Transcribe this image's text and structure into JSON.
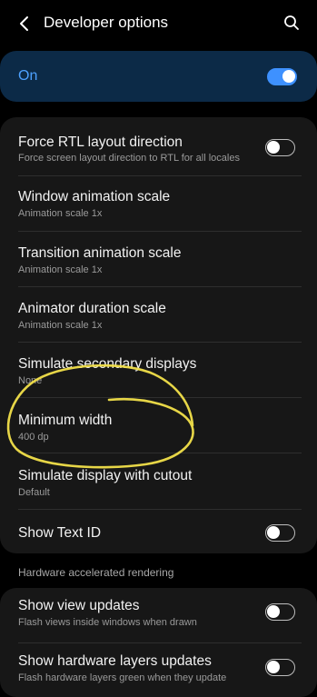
{
  "header": {
    "title": "Developer options",
    "back_icon": "back-arrow-icon",
    "search_icon": "search-icon"
  },
  "master_switch": {
    "label": "On",
    "state": "on"
  },
  "settings": [
    {
      "title": "Force RTL layout direction",
      "subtitle": "Force screen layout direction to RTL for all locales",
      "toggle": "off"
    },
    {
      "title": "Window animation scale",
      "subtitle": "Animation scale 1x"
    },
    {
      "title": "Transition animation scale",
      "subtitle": "Animation scale 1x"
    },
    {
      "title": "Animator duration scale",
      "subtitle": "Animation scale 1x"
    },
    {
      "title": "Simulate secondary displays",
      "subtitle": "None"
    },
    {
      "title": "Minimum width",
      "subtitle": "400 dp"
    },
    {
      "title": "Simulate display with cutout",
      "subtitle": "Default"
    },
    {
      "title": "Show Text ID",
      "toggle": "off"
    }
  ],
  "section_hardware": {
    "header": "Hardware accelerated rendering",
    "items": [
      {
        "title": "Show view updates",
        "subtitle": "Flash views inside windows when drawn",
        "toggle": "off"
      },
      {
        "title": "Show hardware layers updates",
        "subtitle": "Flash hardware layers green when they update",
        "toggle": "off"
      }
    ]
  },
  "colors": {
    "background": "#000000",
    "card": "#171717",
    "master_card": "#0c2a47",
    "accent": "#3e91ff",
    "annotation": "#f2e04a"
  }
}
